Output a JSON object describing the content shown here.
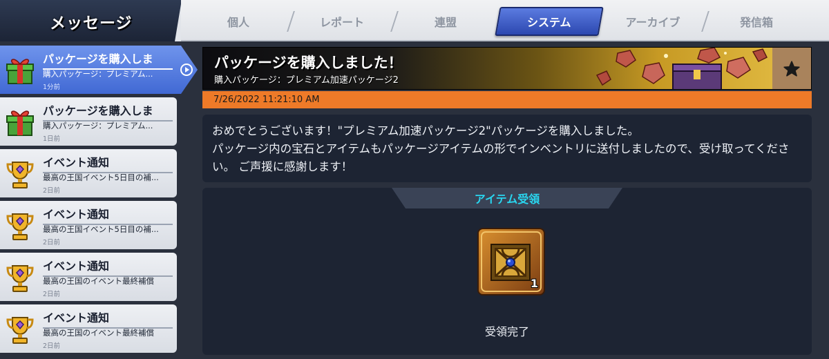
{
  "header": {
    "title": "メッセージ"
  },
  "tabs": [
    {
      "label": "個人",
      "active": false
    },
    {
      "label": "レポート",
      "active": false
    },
    {
      "label": "連盟",
      "active": false
    },
    {
      "label": "システム",
      "active": true
    },
    {
      "label": "アーカイブ",
      "active": false
    },
    {
      "label": "発信箱",
      "active": false
    }
  ],
  "messages": [
    {
      "icon": "gift-box-icon",
      "title": "パッケージを購入しま",
      "subtitle": "購入パッケージ：プレミアム...",
      "time": "1分前",
      "selected": true
    },
    {
      "icon": "gift-box-icon",
      "title": "パッケージを購入しま",
      "subtitle": "購入パッケージ：プレミアム...",
      "time": "1日前",
      "selected": false
    },
    {
      "icon": "trophy-icon",
      "title": "イベント通知",
      "subtitle": "最高の王国イベント5日目の補...",
      "time": "2日前",
      "selected": false
    },
    {
      "icon": "trophy-icon",
      "title": "イベント通知",
      "subtitle": "最高の王国イベント5日目の補...",
      "time": "2日前",
      "selected": false
    },
    {
      "icon": "trophy-icon",
      "title": "イベント通知",
      "subtitle": "最高の王国のイベント最終補償",
      "time": "2日前",
      "selected": false
    },
    {
      "icon": "trophy-icon",
      "title": "イベント通知",
      "subtitle": "最高の王国のイベント最終補償",
      "time": "2日前",
      "selected": false
    }
  ],
  "detail": {
    "title": "パッケージを購入しました！",
    "subtitle": "購入パッケージ：プレミアム加速パッケージ2",
    "date": "7/26/2022 11:21:10 AM",
    "body_line1": "おめでとうございます！\"プレミアム加速パッケージ2\"パッケージを購入しました。",
    "body_line2": "パッケージ内の宝石とアイテムもパッケージアイテムの形でインベントリに送付しましたので、受け取ってください。 ご声援に感謝します！",
    "reward_header": "アイテム受領",
    "reward_quantity": "1",
    "reward_icon": "treasure-chest-icon",
    "claimed_label": "受領完了"
  },
  "colors": {
    "accent_blue": "#4169d4",
    "date_bar": "#ee7a28",
    "reward_header_text": "#29d6f0"
  }
}
